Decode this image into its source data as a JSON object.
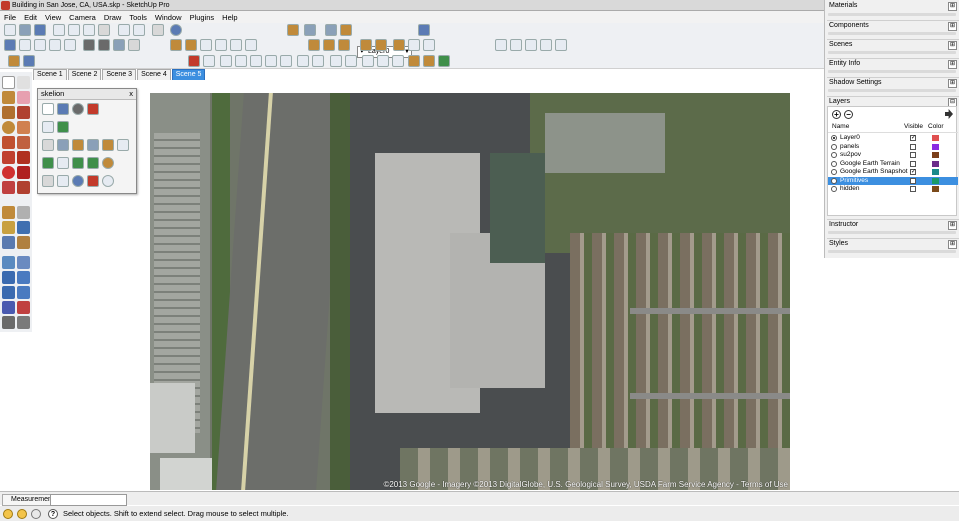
{
  "window": {
    "title": "Building in San Jose, CA, USA.skp - SketchUp Pro"
  },
  "menu": [
    "File",
    "Edit",
    "View",
    "Camera",
    "Draw",
    "Tools",
    "Window",
    "Plugins",
    "Help"
  ],
  "toolbar": {
    "layer_selected": "Layer0"
  },
  "scene_tabs": [
    {
      "label": "Scene 1",
      "active": false
    },
    {
      "label": "Scene 2",
      "active": false
    },
    {
      "label": "Scene 3",
      "active": false
    },
    {
      "label": "Scene 4",
      "active": false
    },
    {
      "label": "Scene 5",
      "active": true
    }
  ],
  "skelion": {
    "title": "skelion",
    "close": "x"
  },
  "viewport": {
    "copyright": "©2013 Google - Imagery ©2013 DigitalGlobe, U.S. Geological Survey, USDA Farm Service Agency - Terms of Use"
  },
  "dock": {
    "panels": [
      "Materials",
      "Components",
      "Scenes",
      "Entity Info",
      "Shadow Settings",
      "Layers",
      "Instructor",
      "Styles"
    ],
    "layers": {
      "columns": {
        "name": "Name",
        "visible": "Visible",
        "color": "Color"
      },
      "rows": [
        {
          "name": "Layer0",
          "active": true,
          "visible": true,
          "color": "#e05050",
          "selected": false
        },
        {
          "name": "panels",
          "active": false,
          "visible": false,
          "color": "#8a2be2",
          "selected": false
        },
        {
          "name": "su2pov",
          "active": false,
          "visible": false,
          "color": "#7b3f1a",
          "selected": false
        },
        {
          "name": "Google Earth Terrain",
          "active": false,
          "visible": false,
          "color": "#6b2c8a",
          "selected": false
        },
        {
          "name": "Google Earth Snapshot",
          "active": false,
          "visible": true,
          "color": "#1a8a8a",
          "selected": false
        },
        {
          "name": "Primitives",
          "active": false,
          "visible": false,
          "color": "#1a9a6a",
          "selected": true
        },
        {
          "name": "hidden",
          "active": false,
          "visible": false,
          "color": "#7b4a1a",
          "selected": false
        }
      ]
    }
  },
  "measurements": {
    "label": "Measurements",
    "value": ""
  },
  "status": {
    "text": "Select objects. Shift to extend select. Drag mouse to select multiple."
  }
}
